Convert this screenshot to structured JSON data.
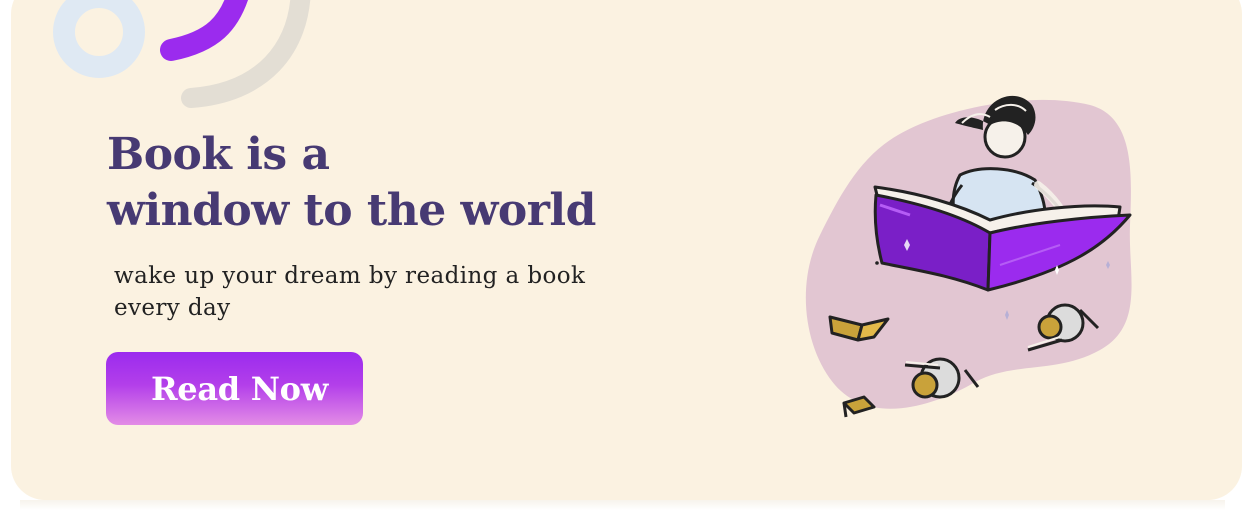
{
  "banner": {
    "headline_line1": "Book is a",
    "headline_line2": "window to the world",
    "subtitle": "wake up your dream by reading a book every day",
    "cta_label": "Read Now"
  },
  "colors": {
    "background": "#FBF2E1",
    "headline": "#473A73",
    "accent_purple": "#9B2BEE",
    "blob_pink": "#E2C6D2",
    "ring_blue": "#DFE9F3",
    "arc_gray": "#E3DED4"
  },
  "icons": {
    "illustration": "girl-riding-book-icon"
  }
}
